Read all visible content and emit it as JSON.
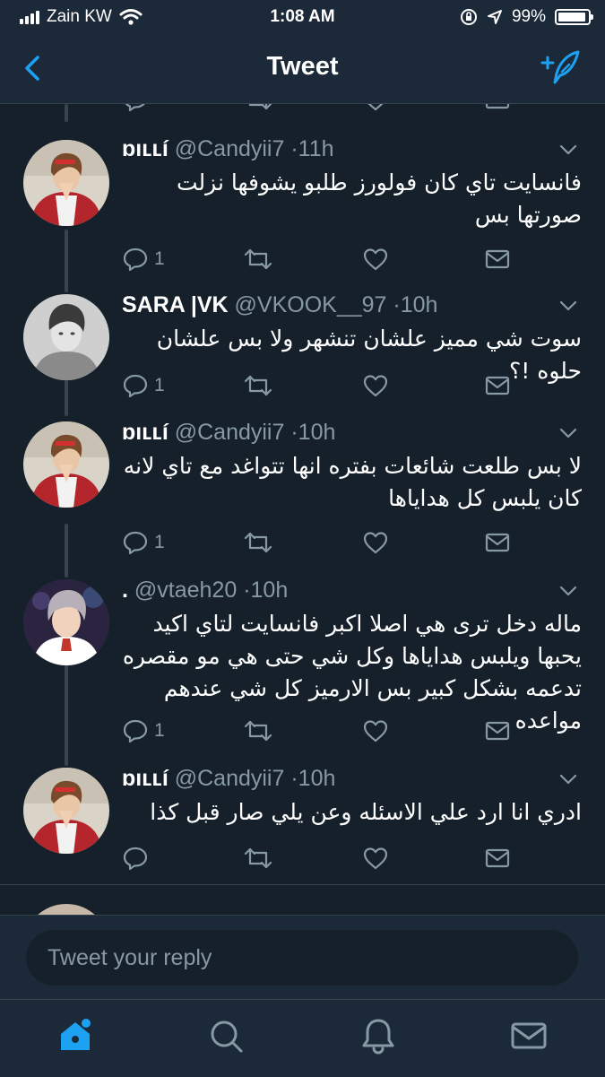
{
  "status_bar": {
    "carrier": "Zain KW",
    "time": "1:08 AM",
    "battery": "99%"
  },
  "header": {
    "title": "Tweet",
    "back_icon": "chevron-left-icon",
    "compose_icon": "compose-tweet-icon"
  },
  "colors": {
    "background": "#15202b",
    "bar": "#1c2938",
    "accent": "#1da1f2",
    "muted": "#8899a6",
    "divider": "#38444d"
  },
  "tweets": [
    {
      "name": "ɒıʟʟí",
      "handle": "@Candyii7",
      "sep": "·",
      "time": "11h",
      "text": "فانسايت تاي كان فولورز طلبو يشوفها نزلت صورتها بس",
      "reply_count": "1"
    },
    {
      "name": "SARA |VK",
      "handle": "@VKOOK__97",
      "sep": "·",
      "time": "10h",
      "text": "سوت شي مميز علشان تنشهر ولا بس علشان حلوه !؟",
      "reply_count": "1"
    },
    {
      "name": "ɒıʟʟí",
      "handle": "@Candyii7",
      "sep": "·",
      "time": "10h",
      "text": "لا بس طلعت شائعات بفتره انها تتواغد مع تاي لانه كان يلبس كل هداياها",
      "reply_count": "1"
    },
    {
      "name": ".",
      "handle": "@vtaeh20",
      "sep": "·",
      "time": "10h",
      "text": "ماله دخل ترى هي اصلا اكبر فانسايت لتاي اكيد يحبها ويلبس هداياها وكل شي حتى هي مو مقصره تدعمه بشكل كبير بس الارميز كل شي عندهم مواعده",
      "reply_count": "1"
    },
    {
      "name": "ɒıʟʟí",
      "handle": "@Candyii7",
      "sep": "·",
      "time": "10h",
      "text": "ادري انا ارد علي الاسئله وعن يلي صار قبل كذا",
      "reply_count": ""
    }
  ],
  "reply": {
    "placeholder": "Tweet your reply"
  },
  "tab_bar": {
    "items": [
      "home-icon",
      "search-icon",
      "notifications-icon",
      "messages-icon"
    ]
  }
}
